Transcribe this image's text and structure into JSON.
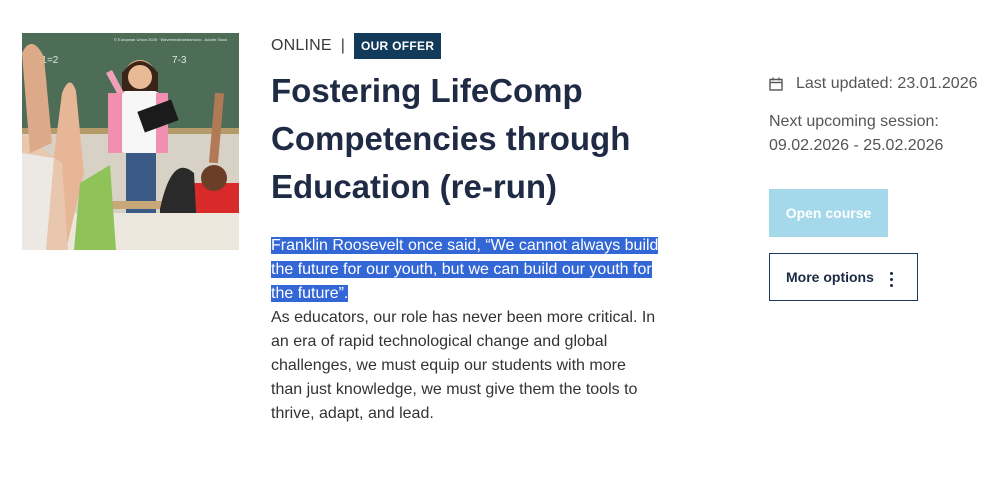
{
  "course": {
    "mode": "ONLINE",
    "separator": "|",
    "badge": "OUR OFFER",
    "title": "Fostering LifeComp Competencies through Education (re-run)",
    "description_highlighted": "Franklin Roosevelt once said, “We cannot always build the future for our youth, but we can build our youth for the future”.",
    "description_rest": "As educators, our role has never been more critical. In an era of rapid technological change and global challenges, we must equip our students with more than just knowledge, we must give them the tools to thrive, adapt, and lead.",
    "image_watermark": "© European Union 2026 · Wavebreakmediamicro - Adobe Stock"
  },
  "sidebar": {
    "updated_icon": "calendar-icon",
    "last_updated": "Last updated: 23.01.2026",
    "next_session_label": "Next upcoming session:",
    "next_session_dates": "09.02.2026 - 25.02.2026",
    "open_course_label": "Open course",
    "more_options_label": "More options",
    "more_options_icon": "kebab-menu-icon"
  },
  "colors": {
    "badge_bg": "#123a5a",
    "title": "#1f2a44",
    "highlight": "#3367d6",
    "open_button": "#a5d8ea",
    "outline_button_border": "#1b3a5c"
  }
}
